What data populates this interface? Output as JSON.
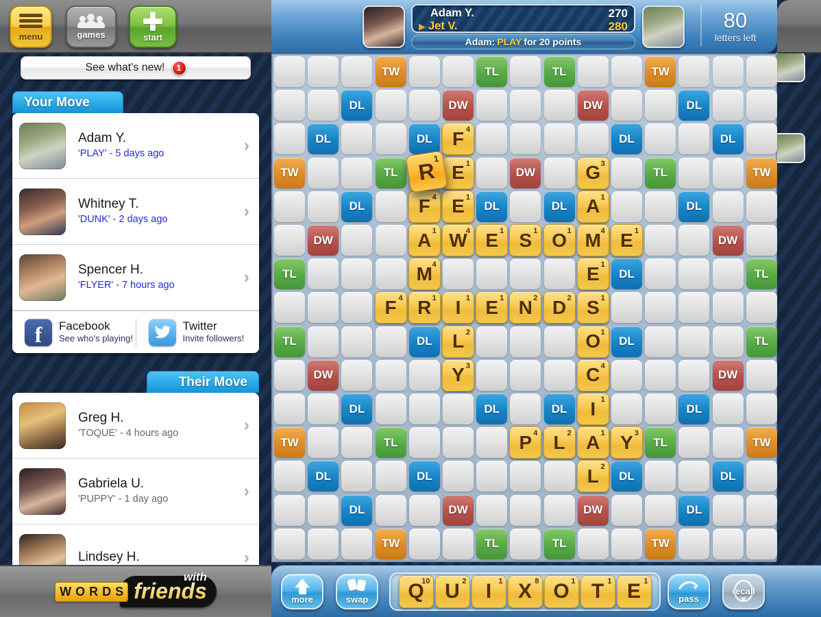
{
  "topbar": {
    "menu_label": "menu",
    "games_label": "games",
    "start_label": "start"
  },
  "whats_new": {
    "label": "See what's new!",
    "badge": "1"
  },
  "your_move": {
    "tab_label": "Your Move",
    "games": [
      {
        "name": "Adam Y.",
        "sub": "'PLAY' - 5 days ago",
        "chevron": "›"
      },
      {
        "name": "Whitney T.",
        "sub": "'DUNK' - 2 days ago",
        "chevron": "›"
      },
      {
        "name": "Spencer H.",
        "sub": "'FLYER' - 7 hours ago",
        "chevron": "›"
      }
    ]
  },
  "social": {
    "facebook": {
      "title": "Facebook",
      "sub": "See who's playing!"
    },
    "twitter": {
      "title": "Twitter",
      "sub": "Invite followers!"
    }
  },
  "their_move": {
    "tab_label": "Their Move",
    "games": [
      {
        "name": "Greg H.",
        "sub": "'TOQUE' - 4 hours ago",
        "chevron": "›"
      },
      {
        "name": "Gabriela U.",
        "sub": "'PUPPY' - 1 day ago",
        "chevron": "›"
      },
      {
        "name": "Lindsey H.",
        "sub": "",
        "chevron": "›"
      }
    ]
  },
  "logo": {
    "words": "WORDS",
    "with": "with",
    "friends": "friends"
  },
  "header": {
    "players": [
      {
        "name": "Adam Y.",
        "score": "270",
        "active": false
      },
      {
        "name": "Jet V.",
        "score": "280",
        "active": true
      }
    ],
    "move_banner": {
      "prefix": "Adam:",
      "word": "PLAY",
      "suffix": "for 20 points"
    },
    "tiles_left": {
      "count": "80",
      "label": "letters left"
    }
  },
  "rack": {
    "tiles": [
      {
        "letter": "Q",
        "points": "10"
      },
      {
        "letter": "U",
        "points": "2"
      },
      {
        "letter": "I",
        "points": "1"
      },
      {
        "letter": "X",
        "points": "8"
      },
      {
        "letter": "O",
        "points": "1"
      },
      {
        "letter": "T",
        "points": "1"
      },
      {
        "letter": "E",
        "points": "1"
      }
    ],
    "more_label": "more",
    "swap_label": "swap",
    "pass_label": "pass",
    "recall_label": "recall"
  },
  "board": {
    "size": 15,
    "bonuses": [
      {
        "r": 0,
        "c": 3,
        "t": "TW"
      },
      {
        "r": 0,
        "c": 6,
        "t": "TL"
      },
      {
        "r": 0,
        "c": 8,
        "t": "TL"
      },
      {
        "r": 0,
        "c": 11,
        "t": "TW"
      },
      {
        "r": 1,
        "c": 2,
        "t": "DL"
      },
      {
        "r": 1,
        "c": 5,
        "t": "DW"
      },
      {
        "r": 1,
        "c": 9,
        "t": "DW"
      },
      {
        "r": 1,
        "c": 12,
        "t": "DL"
      },
      {
        "r": 2,
        "c": 1,
        "t": "DL"
      },
      {
        "r": 2,
        "c": 4,
        "t": "DL"
      },
      {
        "r": 2,
        "c": 10,
        "t": "DL"
      },
      {
        "r": 2,
        "c": 13,
        "t": "DL"
      },
      {
        "r": 3,
        "c": 0,
        "t": "TW"
      },
      {
        "r": 3,
        "c": 3,
        "t": "TL"
      },
      {
        "r": 3,
        "c": 7,
        "t": "DW"
      },
      {
        "r": 3,
        "c": 11,
        "t": "TL"
      },
      {
        "r": 3,
        "c": 14,
        "t": "TW"
      },
      {
        "r": 4,
        "c": 2,
        "t": "DL"
      },
      {
        "r": 4,
        "c": 6,
        "t": "DL"
      },
      {
        "r": 4,
        "c": 8,
        "t": "DL"
      },
      {
        "r": 4,
        "c": 12,
        "t": "DL"
      },
      {
        "r": 5,
        "c": 1,
        "t": "DW"
      },
      {
        "r": 5,
        "c": 13,
        "t": "DW"
      },
      {
        "r": 6,
        "c": 0,
        "t": "TL"
      },
      {
        "r": 6,
        "c": 4,
        "t": "DL"
      },
      {
        "r": 6,
        "c": 10,
        "t": "DL"
      },
      {
        "r": 6,
        "c": 14,
        "t": "TL"
      },
      {
        "r": 8,
        "c": 0,
        "t": "TL"
      },
      {
        "r": 8,
        "c": 4,
        "t": "DL"
      },
      {
        "r": 8,
        "c": 10,
        "t": "DL"
      },
      {
        "r": 8,
        "c": 14,
        "t": "TL"
      },
      {
        "r": 9,
        "c": 1,
        "t": "DW"
      },
      {
        "r": 9,
        "c": 13,
        "t": "DW"
      },
      {
        "r": 10,
        "c": 2,
        "t": "DL"
      },
      {
        "r": 10,
        "c": 6,
        "t": "DL"
      },
      {
        "r": 10,
        "c": 8,
        "t": "DL"
      },
      {
        "r": 10,
        "c": 12,
        "t": "DL"
      },
      {
        "r": 11,
        "c": 0,
        "t": "TW"
      },
      {
        "r": 11,
        "c": 3,
        "t": "TL"
      },
      {
        "r": 11,
        "c": 11,
        "t": "TL"
      },
      {
        "r": 11,
        "c": 14,
        "t": "TW"
      },
      {
        "r": 12,
        "c": 1,
        "t": "DL"
      },
      {
        "r": 12,
        "c": 4,
        "t": "DL"
      },
      {
        "r": 12,
        "c": 10,
        "t": "DL"
      },
      {
        "r": 12,
        "c": 13,
        "t": "DL"
      },
      {
        "r": 13,
        "c": 2,
        "t": "DL"
      },
      {
        "r": 13,
        "c": 5,
        "t": "DW"
      },
      {
        "r": 13,
        "c": 9,
        "t": "DW"
      },
      {
        "r": 13,
        "c": 12,
        "t": "DL"
      },
      {
        "r": 14,
        "c": 3,
        "t": "TW"
      },
      {
        "r": 14,
        "c": 6,
        "t": "TL"
      },
      {
        "r": 14,
        "c": 8,
        "t": "TL"
      },
      {
        "r": 14,
        "c": 11,
        "t": "TW"
      }
    ],
    "tiles": [
      {
        "r": 2,
        "c": 5,
        "letter": "F",
        "points": "4"
      },
      {
        "r": 3,
        "c": 5,
        "letter": "E",
        "points": "1"
      },
      {
        "r": 4,
        "c": 4,
        "letter": "F",
        "points": "4"
      },
      {
        "r": 4,
        "c": 5,
        "letter": "E",
        "points": "1"
      },
      {
        "r": 3,
        "c": 9,
        "letter": "G",
        "points": "3"
      },
      {
        "r": 4,
        "c": 9,
        "letter": "A",
        "points": "1"
      },
      {
        "r": 5,
        "c": 4,
        "letter": "A",
        "points": "1"
      },
      {
        "r": 5,
        "c": 5,
        "letter": "W",
        "points": "4"
      },
      {
        "r": 5,
        "c": 6,
        "letter": "E",
        "points": "1"
      },
      {
        "r": 5,
        "c": 7,
        "letter": "S",
        "points": "1"
      },
      {
        "r": 5,
        "c": 8,
        "letter": "O",
        "points": "1"
      },
      {
        "r": 5,
        "c": 9,
        "letter": "M",
        "points": "4"
      },
      {
        "r": 5,
        "c": 10,
        "letter": "E",
        "points": "1"
      },
      {
        "r": 6,
        "c": 4,
        "letter": "M",
        "points": "4"
      },
      {
        "r": 6,
        "c": 9,
        "letter": "E",
        "points": "1"
      },
      {
        "r": 7,
        "c": 3,
        "letter": "F",
        "points": "4"
      },
      {
        "r": 7,
        "c": 4,
        "letter": "R",
        "points": "1"
      },
      {
        "r": 7,
        "c": 5,
        "letter": "I",
        "points": "1"
      },
      {
        "r": 7,
        "c": 6,
        "letter": "E",
        "points": "1"
      },
      {
        "r": 7,
        "c": 7,
        "letter": "N",
        "points": "2"
      },
      {
        "r": 7,
        "c": 8,
        "letter": "D",
        "points": "2"
      },
      {
        "r": 7,
        "c": 9,
        "letter": "S",
        "points": "1"
      },
      {
        "r": 8,
        "c": 5,
        "letter": "L",
        "points": "2"
      },
      {
        "r": 8,
        "c": 9,
        "letter": "O",
        "points": "1"
      },
      {
        "r": 9,
        "c": 5,
        "letter": "Y",
        "points": "3"
      },
      {
        "r": 9,
        "c": 9,
        "letter": "C",
        "points": "4"
      },
      {
        "r": 10,
        "c": 9,
        "letter": "I",
        "points": "1"
      },
      {
        "r": 11,
        "c": 7,
        "letter": "P",
        "points": "4"
      },
      {
        "r": 11,
        "c": 8,
        "letter": "L",
        "points": "2"
      },
      {
        "r": 11,
        "c": 9,
        "letter": "A",
        "points": "1"
      },
      {
        "r": 11,
        "c": 10,
        "letter": "Y",
        "points": "3"
      },
      {
        "r": 12,
        "c": 9,
        "letter": "L",
        "points": "2"
      }
    ],
    "dragging_tile": {
      "r": 3,
      "c": 4,
      "letter": "R",
      "points": "1"
    }
  }
}
